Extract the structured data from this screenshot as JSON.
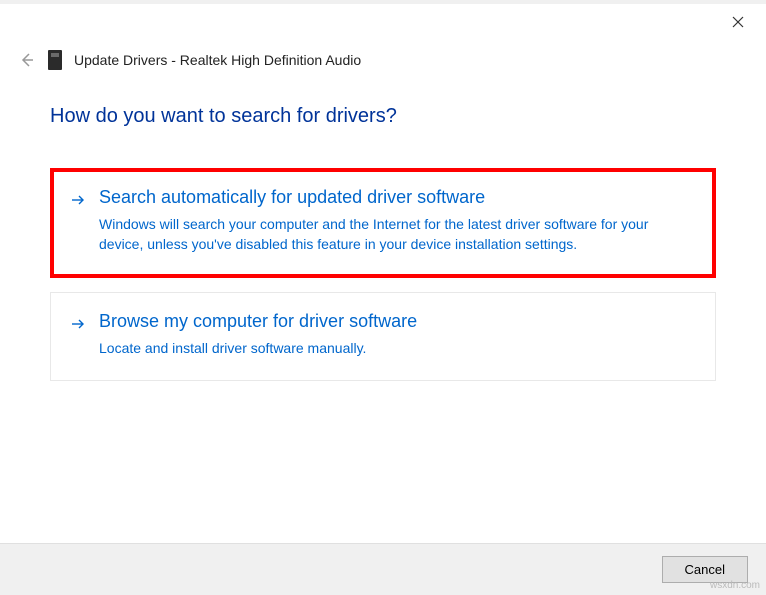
{
  "window": {
    "title": "Update Drivers - Realtek High Definition Audio"
  },
  "heading": "How do you want to search for drivers?",
  "options": [
    {
      "title": "Search automatically for updated driver software",
      "description": "Windows will search your computer and the Internet for the latest driver software for your device, unless you've disabled this feature in your device installation settings.",
      "highlighted": true
    },
    {
      "title": "Browse my computer for driver software",
      "description": "Locate and install driver software manually.",
      "highlighted": false
    }
  ],
  "footer": {
    "cancel_label": "Cancel"
  },
  "watermark": "wsxdn.com"
}
